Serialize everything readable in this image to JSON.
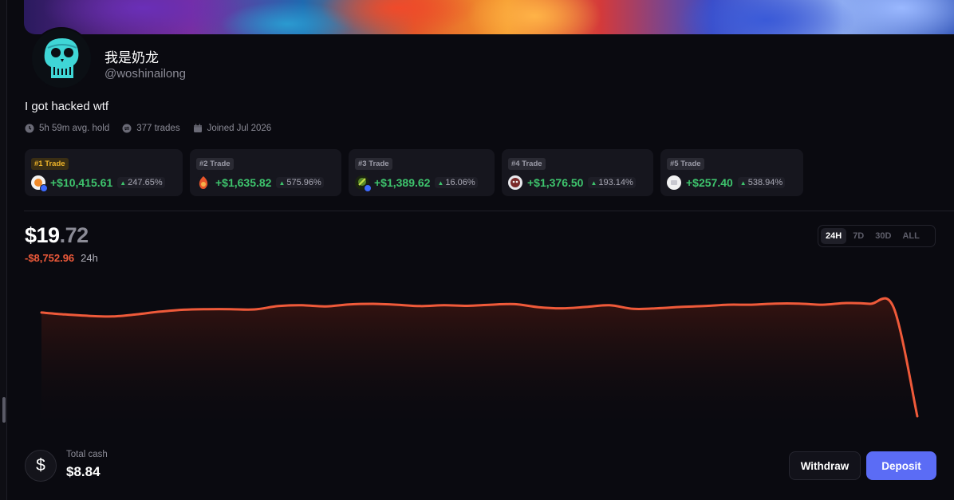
{
  "profile": {
    "display_name": "我是奶龙",
    "handle": "@woshinailong",
    "bio": "I got hacked wtf",
    "avatar_icon": "skull-avatar-icon"
  },
  "stats": {
    "avg_hold": "5h 59m avg. hold",
    "trades": "377 trades",
    "joined": "Joined Jul 2026"
  },
  "top_trades": [
    {
      "badge": "#1 Trade",
      "gain": "+$10,415.61",
      "pct": "247.65%",
      "token_color": "#f3f3f3",
      "verified": true
    },
    {
      "badge": "#2 Trade",
      "gain": "+$1,635.82",
      "pct": "575.96%",
      "token_color": "#e8552a",
      "verified": false
    },
    {
      "badge": "#3 Trade",
      "gain": "+$1,389.62",
      "pct": "16.06%",
      "token_color": "#2a3a1a",
      "verified": true
    },
    {
      "badge": "#4 Trade",
      "gain": "+$1,376.50",
      "pct": "193.14%",
      "token_color": "#7a2a2a",
      "verified": false
    },
    {
      "badge": "#5 Trade",
      "gain": "+$257.40",
      "pct": "538.94%",
      "token_color": "#f2f2f2",
      "verified": false
    }
  ],
  "portfolio": {
    "balance_whole": "$19",
    "balance_cents": ".72",
    "change": "-$8,752.96",
    "change_period": "24h",
    "ranges": [
      "24H",
      "7D",
      "30D",
      "ALL"
    ],
    "active_range": "24H"
  },
  "chart_data": {
    "type": "area",
    "series": [
      {
        "values": [
          8752,
          8745,
          8740,
          8738,
          8745,
          8755,
          8762,
          8764,
          8764,
          8763,
          8775,
          8778,
          8774,
          8781,
          8783,
          8780,
          8775,
          8778,
          8776,
          8780,
          8782,
          8771,
          8767,
          8772,
          8778,
          8765,
          8767,
          8772,
          8775,
          8780,
          8780,
          8784,
          8784,
          8780,
          8786,
          8783,
          8770,
          8380
        ]
      }
    ],
    "color": "#ef5a3a",
    "fill_color": "#2a0f0c"
  },
  "cash": {
    "label": "Total cash",
    "value": "$8.84"
  },
  "actions": {
    "withdraw": "Withdraw",
    "deposit": "Deposit"
  }
}
